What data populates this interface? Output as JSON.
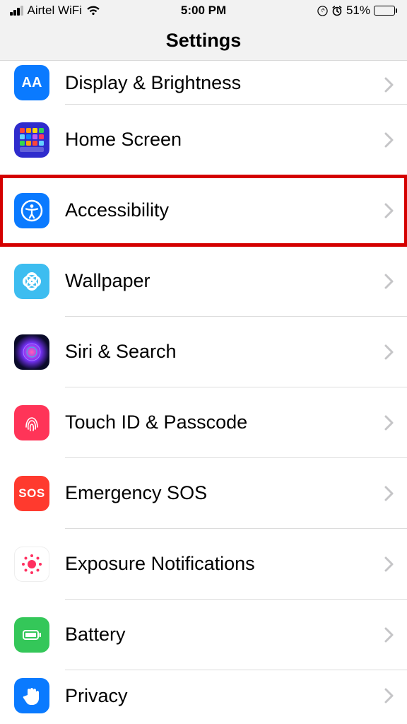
{
  "statusbar": {
    "carrier": "Airtel WiFi",
    "time": "5:00 PM",
    "battery_pct": "51%"
  },
  "header": {
    "title": "Settings"
  },
  "rows": [
    {
      "label": "Display & Brightness",
      "icon": "AA"
    },
    {
      "label": "Home Screen"
    },
    {
      "label": "Accessibility"
    },
    {
      "label": "Wallpaper"
    },
    {
      "label": "Siri & Search"
    },
    {
      "label": "Touch ID & Passcode"
    },
    {
      "label": "Emergency SOS",
      "icon": "SOS"
    },
    {
      "label": "Exposure Notifications"
    },
    {
      "label": "Battery"
    },
    {
      "label": "Privacy"
    }
  ],
  "highlight_index": 2
}
